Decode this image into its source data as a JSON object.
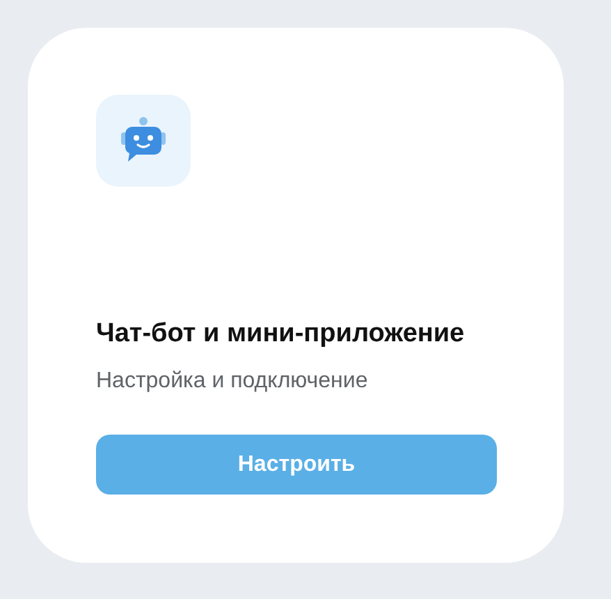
{
  "card": {
    "title": "Чат-бот и мини-приложение",
    "subtitle": "Настройка и подключение",
    "button": "Настроить"
  }
}
